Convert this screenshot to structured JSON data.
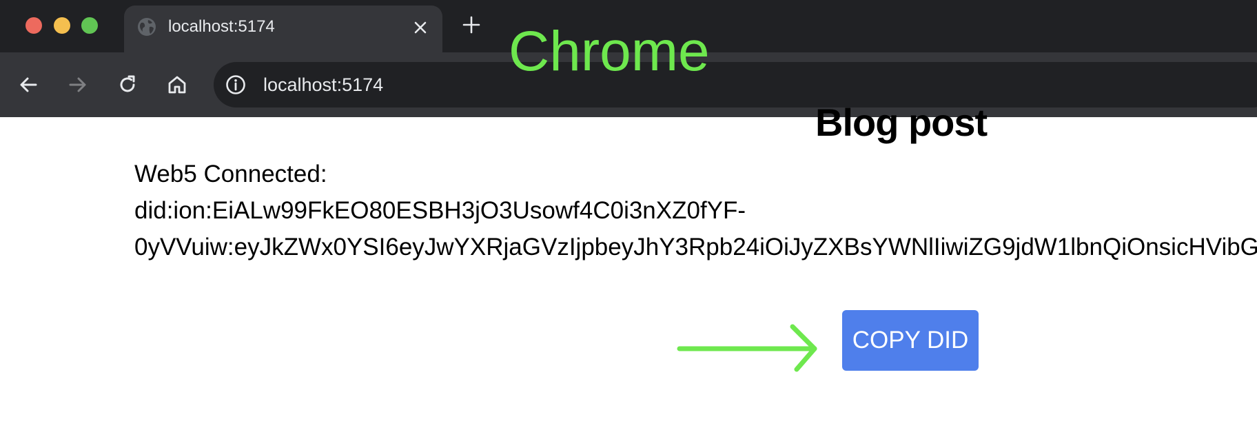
{
  "tab": {
    "title": "localhost:5174",
    "favicon_icon": "globe-icon",
    "close_icon": "close-icon"
  },
  "new_tab_icon": "plus-icon",
  "toolbar": {
    "back_icon": "arrow-left-icon",
    "forward_icon": "arrow-right-icon",
    "reload_icon": "reload-icon",
    "home_icon": "home-icon"
  },
  "omnibox": {
    "info_icon": "info-icon",
    "url": "localhost:5174"
  },
  "annotation": {
    "label": "Chrome",
    "color": "#6ee84e",
    "arrow_icon": "arrow-right-annotation-icon"
  },
  "page": {
    "heading": "Blog post",
    "did_label": "Web5 Connected:",
    "did_line1": "did:ion:EiALw99FkEO80ESBH3jO3Usowf4C0i3nXZ0fYF-",
    "did_line2": "0yVVuiw:eyJkZWx0YSI6eyJwYXRjaGVzIjpbeyJhY3Rpb24iOiJyZXBsYWNlIiwiZG9jdW1lbnQiOnsicHVibG",
    "copy_button": "COPY DID",
    "button_color": "#4f7feb"
  }
}
